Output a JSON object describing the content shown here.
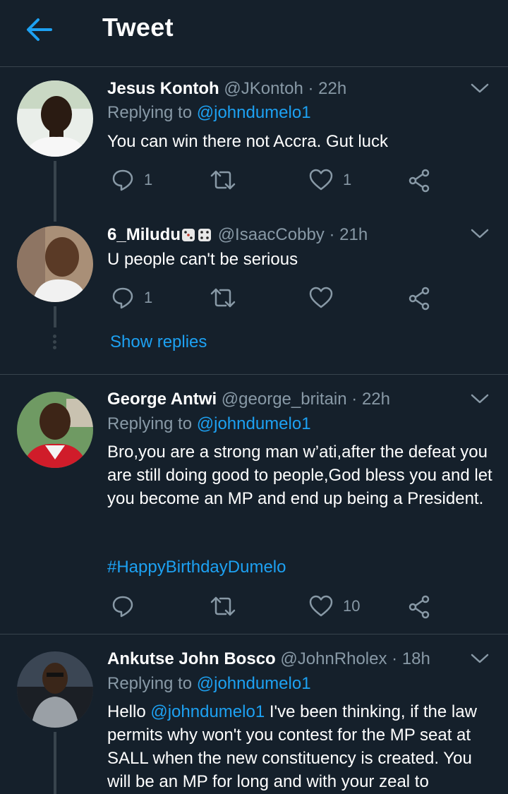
{
  "header": {
    "title": "Tweet",
    "back_icon": "arrow-left-icon",
    "accent_color": "#1da1f2"
  },
  "tweets": [
    {
      "name": "Jesus Kontoh",
      "handle": "@JKontoh",
      "time": "· 22h",
      "replying_prefix": "Replying to ",
      "replying_to": "@johndumelo1",
      "text": "You can win there not Accra. Gut luck",
      "reply_count": "1",
      "retweet_count": "",
      "like_count": "1"
    },
    {
      "name": "6_Miludu",
      "name_emoji": "dice-icon",
      "handle": "@IsaacCobby",
      "time": "· 21h",
      "text": "U people can't be serious",
      "reply_count": "1",
      "retweet_count": "",
      "like_count": "",
      "show_replies": "Show replies"
    },
    {
      "name": "George Antwi",
      "handle": "@george_britain",
      "time": "· 22h",
      "replying_prefix": "Replying to ",
      "replying_to": "@johndumelo1",
      "text": "Bro,you are a strong man w’ati,after the defeat you are still doing good to people,God bless you and let you become an MP and end up being a President.",
      "hashtag": "#HappyBirthdayDumelo",
      "reply_count": "",
      "retweet_count": "",
      "like_count": "10"
    },
    {
      "name": "Ankutse John Bosco",
      "handle": "@JohnRholex",
      "time": "· 18h",
      "replying_prefix": "Replying to ",
      "replying_to": "@johndumelo1",
      "text_prefix": "Hello ",
      "text_mention": "@johndumelo1",
      "text": " I've been thinking, if the law permits why won't you contest for the MP seat at SALL when the new constituency is created. You will be an MP for long and with your zeal to"
    }
  ],
  "colors": {
    "background": "#15202b",
    "secondary_text": "#8899a6",
    "link": "#1da1f2",
    "divider": "#38444d"
  }
}
